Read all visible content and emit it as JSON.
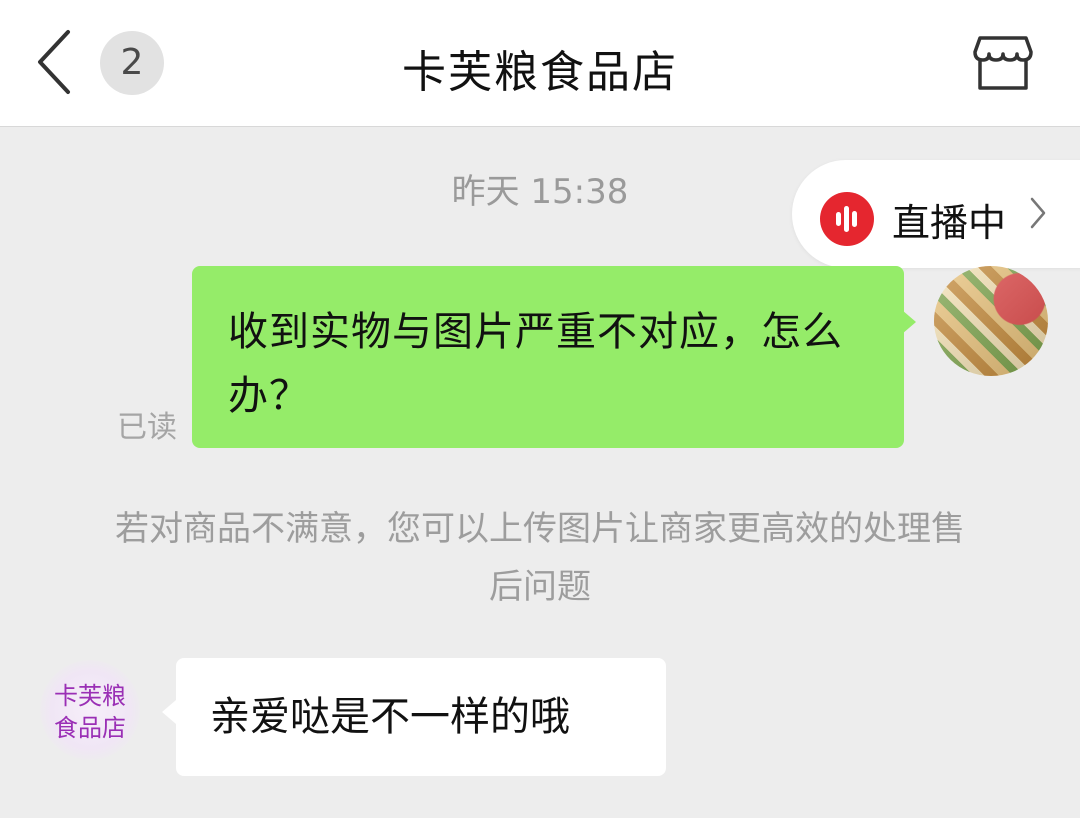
{
  "header": {
    "unread_count": "2",
    "title": "卡芙粮食品店"
  },
  "chat": {
    "timestamp": "昨天 15:38",
    "outgoing_message": "收到实物与图片严重不对应，怎么办？",
    "read_status": "已读",
    "system_notice": "若对商品不满意，您可以上传图片让商家更高效的处理售后问题",
    "incoming_message": "亲爱哒是不一样的哦",
    "shop_avatar_text": "卡芙粮食品店"
  },
  "live": {
    "label": "直播中"
  },
  "colors": {
    "outgoing_bubble": "#95ec69",
    "live_accent": "#e5262f",
    "shop_avatar_text": "#9a2fb5"
  },
  "icons": [
    "back-arrow-icon",
    "store-icon",
    "live-audio-icon",
    "chevron-right-icon"
  ]
}
